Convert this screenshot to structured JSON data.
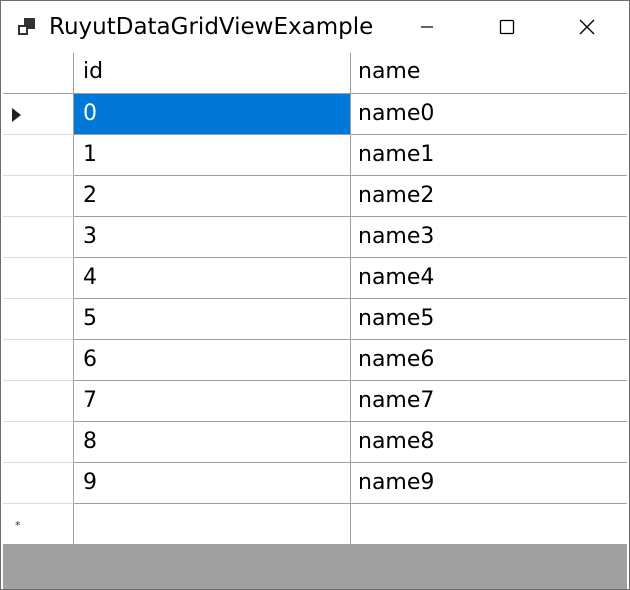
{
  "window": {
    "title": "RuyutDataGridViewExample",
    "icon": "app-window-icon",
    "controls": {
      "minimize": "minimize-icon",
      "maximize": "maximize-icon",
      "close": "close-icon"
    }
  },
  "grid": {
    "columns": [
      {
        "header": "id"
      },
      {
        "header": "name"
      }
    ],
    "rows": [
      {
        "id": "0",
        "name": "name0"
      },
      {
        "id": "1",
        "name": "name1"
      },
      {
        "id": "2",
        "name": "name2"
      },
      {
        "id": "3",
        "name": "name3"
      },
      {
        "id": "4",
        "name": "name4"
      },
      {
        "id": "5",
        "name": "name5"
      },
      {
        "id": "6",
        "name": "name6"
      },
      {
        "id": "7",
        "name": "name7"
      },
      {
        "id": "8",
        "name": "name8"
      },
      {
        "id": "9",
        "name": "name9"
      }
    ],
    "selected_row": 0,
    "selected_column": "id",
    "new_row_marker": "*",
    "colors": {
      "selection": "#0078d7",
      "gridline": "#a0a0a0",
      "empty_area": "#a0a0a0"
    }
  }
}
